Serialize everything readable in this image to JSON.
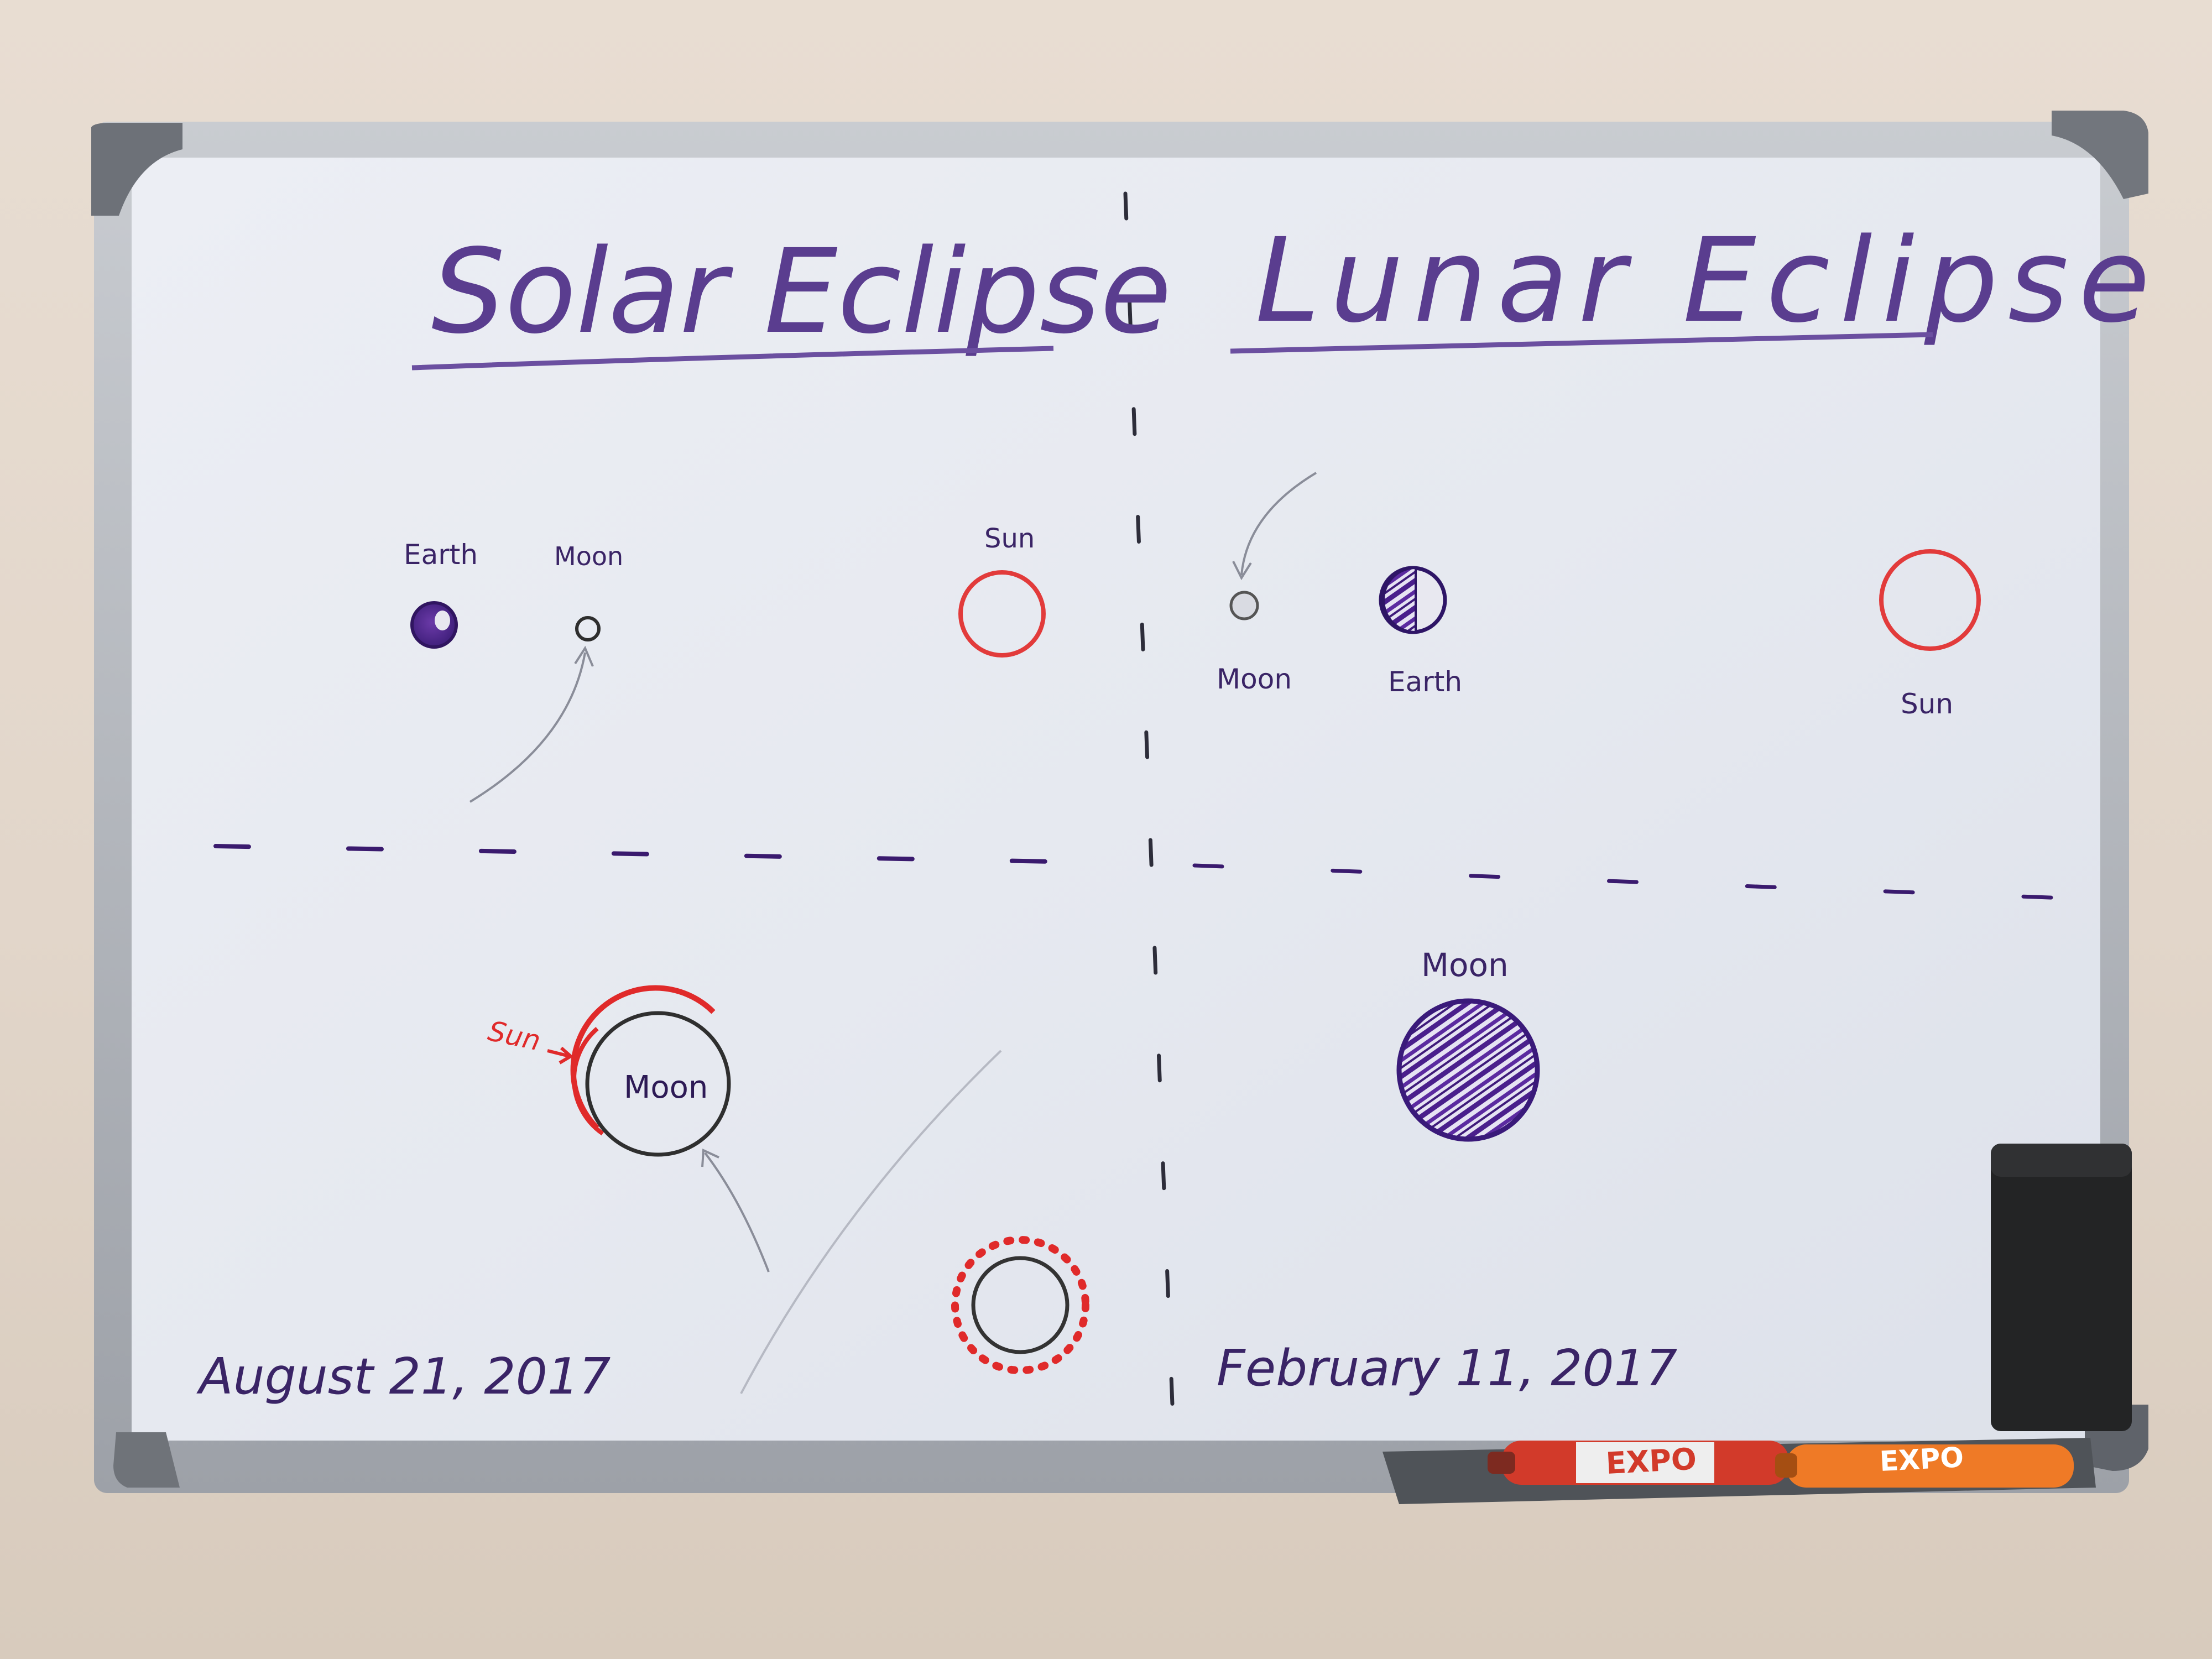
{
  "board": {
    "left_panel": {
      "title": "Solar Eclipse",
      "labels": {
        "earth": "Earth",
        "moon": "Moon",
        "sun": "Sun"
      },
      "detail": {
        "sun": "Sun",
        "moon": "Moon"
      },
      "date": "August 21, 2017"
    },
    "right_panel": {
      "title": "Lunar Eclipse",
      "labels": {
        "moon": "Moon",
        "earth": "Earth",
        "sun": "Sun"
      },
      "detail": {
        "moon": "Moon"
      },
      "date": "February 11, 2017"
    },
    "markers": [
      {
        "brand": "EXPO",
        "color": "#d23a2a"
      },
      {
        "brand": "EXPO",
        "color": "#ef7a26"
      }
    ]
  }
}
